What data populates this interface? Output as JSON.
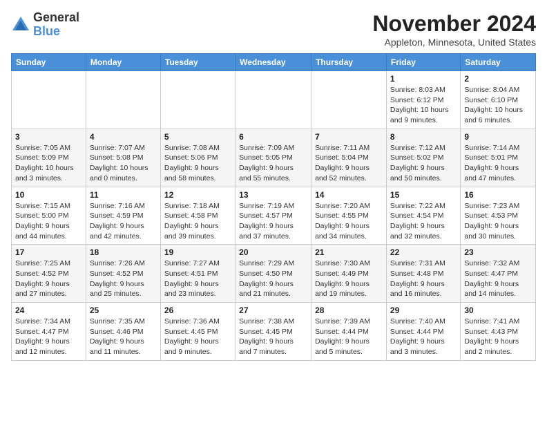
{
  "logo": {
    "general": "General",
    "blue": "Blue"
  },
  "header": {
    "month": "November 2024",
    "location": "Appleton, Minnesota, United States"
  },
  "weekdays": [
    "Sunday",
    "Monday",
    "Tuesday",
    "Wednesday",
    "Thursday",
    "Friday",
    "Saturday"
  ],
  "weeks": [
    [
      {
        "day": "",
        "info": ""
      },
      {
        "day": "",
        "info": ""
      },
      {
        "day": "",
        "info": ""
      },
      {
        "day": "",
        "info": ""
      },
      {
        "day": "",
        "info": ""
      },
      {
        "day": "1",
        "info": "Sunrise: 8:03 AM\nSunset: 6:12 PM\nDaylight: 10 hours\nand 9 minutes."
      },
      {
        "day": "2",
        "info": "Sunrise: 8:04 AM\nSunset: 6:10 PM\nDaylight: 10 hours\nand 6 minutes."
      }
    ],
    [
      {
        "day": "3",
        "info": "Sunrise: 7:05 AM\nSunset: 5:09 PM\nDaylight: 10 hours\nand 3 minutes."
      },
      {
        "day": "4",
        "info": "Sunrise: 7:07 AM\nSunset: 5:08 PM\nDaylight: 10 hours\nand 0 minutes."
      },
      {
        "day": "5",
        "info": "Sunrise: 7:08 AM\nSunset: 5:06 PM\nDaylight: 9 hours\nand 58 minutes."
      },
      {
        "day": "6",
        "info": "Sunrise: 7:09 AM\nSunset: 5:05 PM\nDaylight: 9 hours\nand 55 minutes."
      },
      {
        "day": "7",
        "info": "Sunrise: 7:11 AM\nSunset: 5:04 PM\nDaylight: 9 hours\nand 52 minutes."
      },
      {
        "day": "8",
        "info": "Sunrise: 7:12 AM\nSunset: 5:02 PM\nDaylight: 9 hours\nand 50 minutes."
      },
      {
        "day": "9",
        "info": "Sunrise: 7:14 AM\nSunset: 5:01 PM\nDaylight: 9 hours\nand 47 minutes."
      }
    ],
    [
      {
        "day": "10",
        "info": "Sunrise: 7:15 AM\nSunset: 5:00 PM\nDaylight: 9 hours\nand 44 minutes."
      },
      {
        "day": "11",
        "info": "Sunrise: 7:16 AM\nSunset: 4:59 PM\nDaylight: 9 hours\nand 42 minutes."
      },
      {
        "day": "12",
        "info": "Sunrise: 7:18 AM\nSunset: 4:58 PM\nDaylight: 9 hours\nand 39 minutes."
      },
      {
        "day": "13",
        "info": "Sunrise: 7:19 AM\nSunset: 4:57 PM\nDaylight: 9 hours\nand 37 minutes."
      },
      {
        "day": "14",
        "info": "Sunrise: 7:20 AM\nSunset: 4:55 PM\nDaylight: 9 hours\nand 34 minutes."
      },
      {
        "day": "15",
        "info": "Sunrise: 7:22 AM\nSunset: 4:54 PM\nDaylight: 9 hours\nand 32 minutes."
      },
      {
        "day": "16",
        "info": "Sunrise: 7:23 AM\nSunset: 4:53 PM\nDaylight: 9 hours\nand 30 minutes."
      }
    ],
    [
      {
        "day": "17",
        "info": "Sunrise: 7:25 AM\nSunset: 4:52 PM\nDaylight: 9 hours\nand 27 minutes."
      },
      {
        "day": "18",
        "info": "Sunrise: 7:26 AM\nSunset: 4:52 PM\nDaylight: 9 hours\nand 25 minutes."
      },
      {
        "day": "19",
        "info": "Sunrise: 7:27 AM\nSunset: 4:51 PM\nDaylight: 9 hours\nand 23 minutes."
      },
      {
        "day": "20",
        "info": "Sunrise: 7:29 AM\nSunset: 4:50 PM\nDaylight: 9 hours\nand 21 minutes."
      },
      {
        "day": "21",
        "info": "Sunrise: 7:30 AM\nSunset: 4:49 PM\nDaylight: 9 hours\nand 19 minutes."
      },
      {
        "day": "22",
        "info": "Sunrise: 7:31 AM\nSunset: 4:48 PM\nDaylight: 9 hours\nand 16 minutes."
      },
      {
        "day": "23",
        "info": "Sunrise: 7:32 AM\nSunset: 4:47 PM\nDaylight: 9 hours\nand 14 minutes."
      }
    ],
    [
      {
        "day": "24",
        "info": "Sunrise: 7:34 AM\nSunset: 4:47 PM\nDaylight: 9 hours\nand 12 minutes."
      },
      {
        "day": "25",
        "info": "Sunrise: 7:35 AM\nSunset: 4:46 PM\nDaylight: 9 hours\nand 11 minutes."
      },
      {
        "day": "26",
        "info": "Sunrise: 7:36 AM\nSunset: 4:45 PM\nDaylight: 9 hours\nand 9 minutes."
      },
      {
        "day": "27",
        "info": "Sunrise: 7:38 AM\nSunset: 4:45 PM\nDaylight: 9 hours\nand 7 minutes."
      },
      {
        "day": "28",
        "info": "Sunrise: 7:39 AM\nSunset: 4:44 PM\nDaylight: 9 hours\nand 5 minutes."
      },
      {
        "day": "29",
        "info": "Sunrise: 7:40 AM\nSunset: 4:44 PM\nDaylight: 9 hours\nand 3 minutes."
      },
      {
        "day": "30",
        "info": "Sunrise: 7:41 AM\nSunset: 4:43 PM\nDaylight: 9 hours\nand 2 minutes."
      }
    ]
  ]
}
